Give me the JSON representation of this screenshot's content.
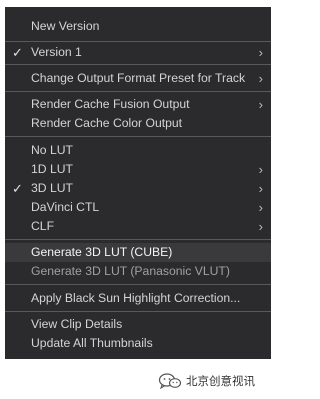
{
  "menu": {
    "items": [
      {
        "label": "New Version"
      },
      {
        "label": "Version 1"
      },
      {
        "label": "Change Output Format Preset for Track"
      },
      {
        "label": "Render Cache Fusion Output"
      },
      {
        "label": "Render Cache Color Output"
      },
      {
        "label": "No LUT"
      },
      {
        "label": "1D LUT"
      },
      {
        "label": "3D LUT"
      },
      {
        "label": "DaVinci CTL"
      },
      {
        "label": "CLF"
      },
      {
        "label": "Generate 3D LUT (CUBE)"
      },
      {
        "label": "Generate 3D LUT (Panasonic VLUT)"
      },
      {
        "label": "Apply Black Sun Highlight Correction..."
      },
      {
        "label": "View Clip Details"
      },
      {
        "label": "Update All Thumbnails"
      }
    ]
  },
  "glyphs": {
    "check": "✓",
    "chevron": "›"
  },
  "watermark": {
    "text": "北京创意视讯",
    "icon": "wechat-icon"
  }
}
